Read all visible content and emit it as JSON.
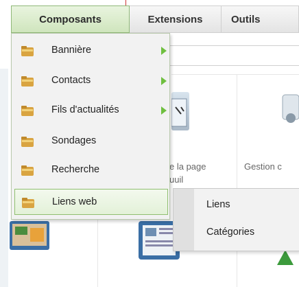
{
  "menubar": {
    "tabs": [
      {
        "label": "Composants",
        "active": true
      },
      {
        "label": "Extensions",
        "active": false
      },
      {
        "label": "Outils",
        "active": false
      }
    ]
  },
  "dropdown": {
    "items": [
      {
        "label": "Bannière",
        "has_submenu": true
      },
      {
        "label": "Contacts",
        "has_submenu": true
      },
      {
        "label": "Fils d'actualités",
        "has_submenu": true
      },
      {
        "label": "Sondages",
        "has_submenu": false
      },
      {
        "label": "Recherche",
        "has_submenu": false
      },
      {
        "label": "Liens web",
        "has_submenu": true,
        "hovered": true
      }
    ]
  },
  "submenu": {
    "items": [
      {
        "label": "Liens"
      },
      {
        "label": "Catégories"
      }
    ]
  },
  "background": {
    "partial_s": "s",
    "card_label_1": "e la page",
    "card_label_1b": "uuil",
    "card_label_2": "Gestion c"
  },
  "colors": {
    "active_tab": "#cfe5bd",
    "arrow": "#6fbf3f",
    "menu_bg": "#f2f2f2"
  }
}
